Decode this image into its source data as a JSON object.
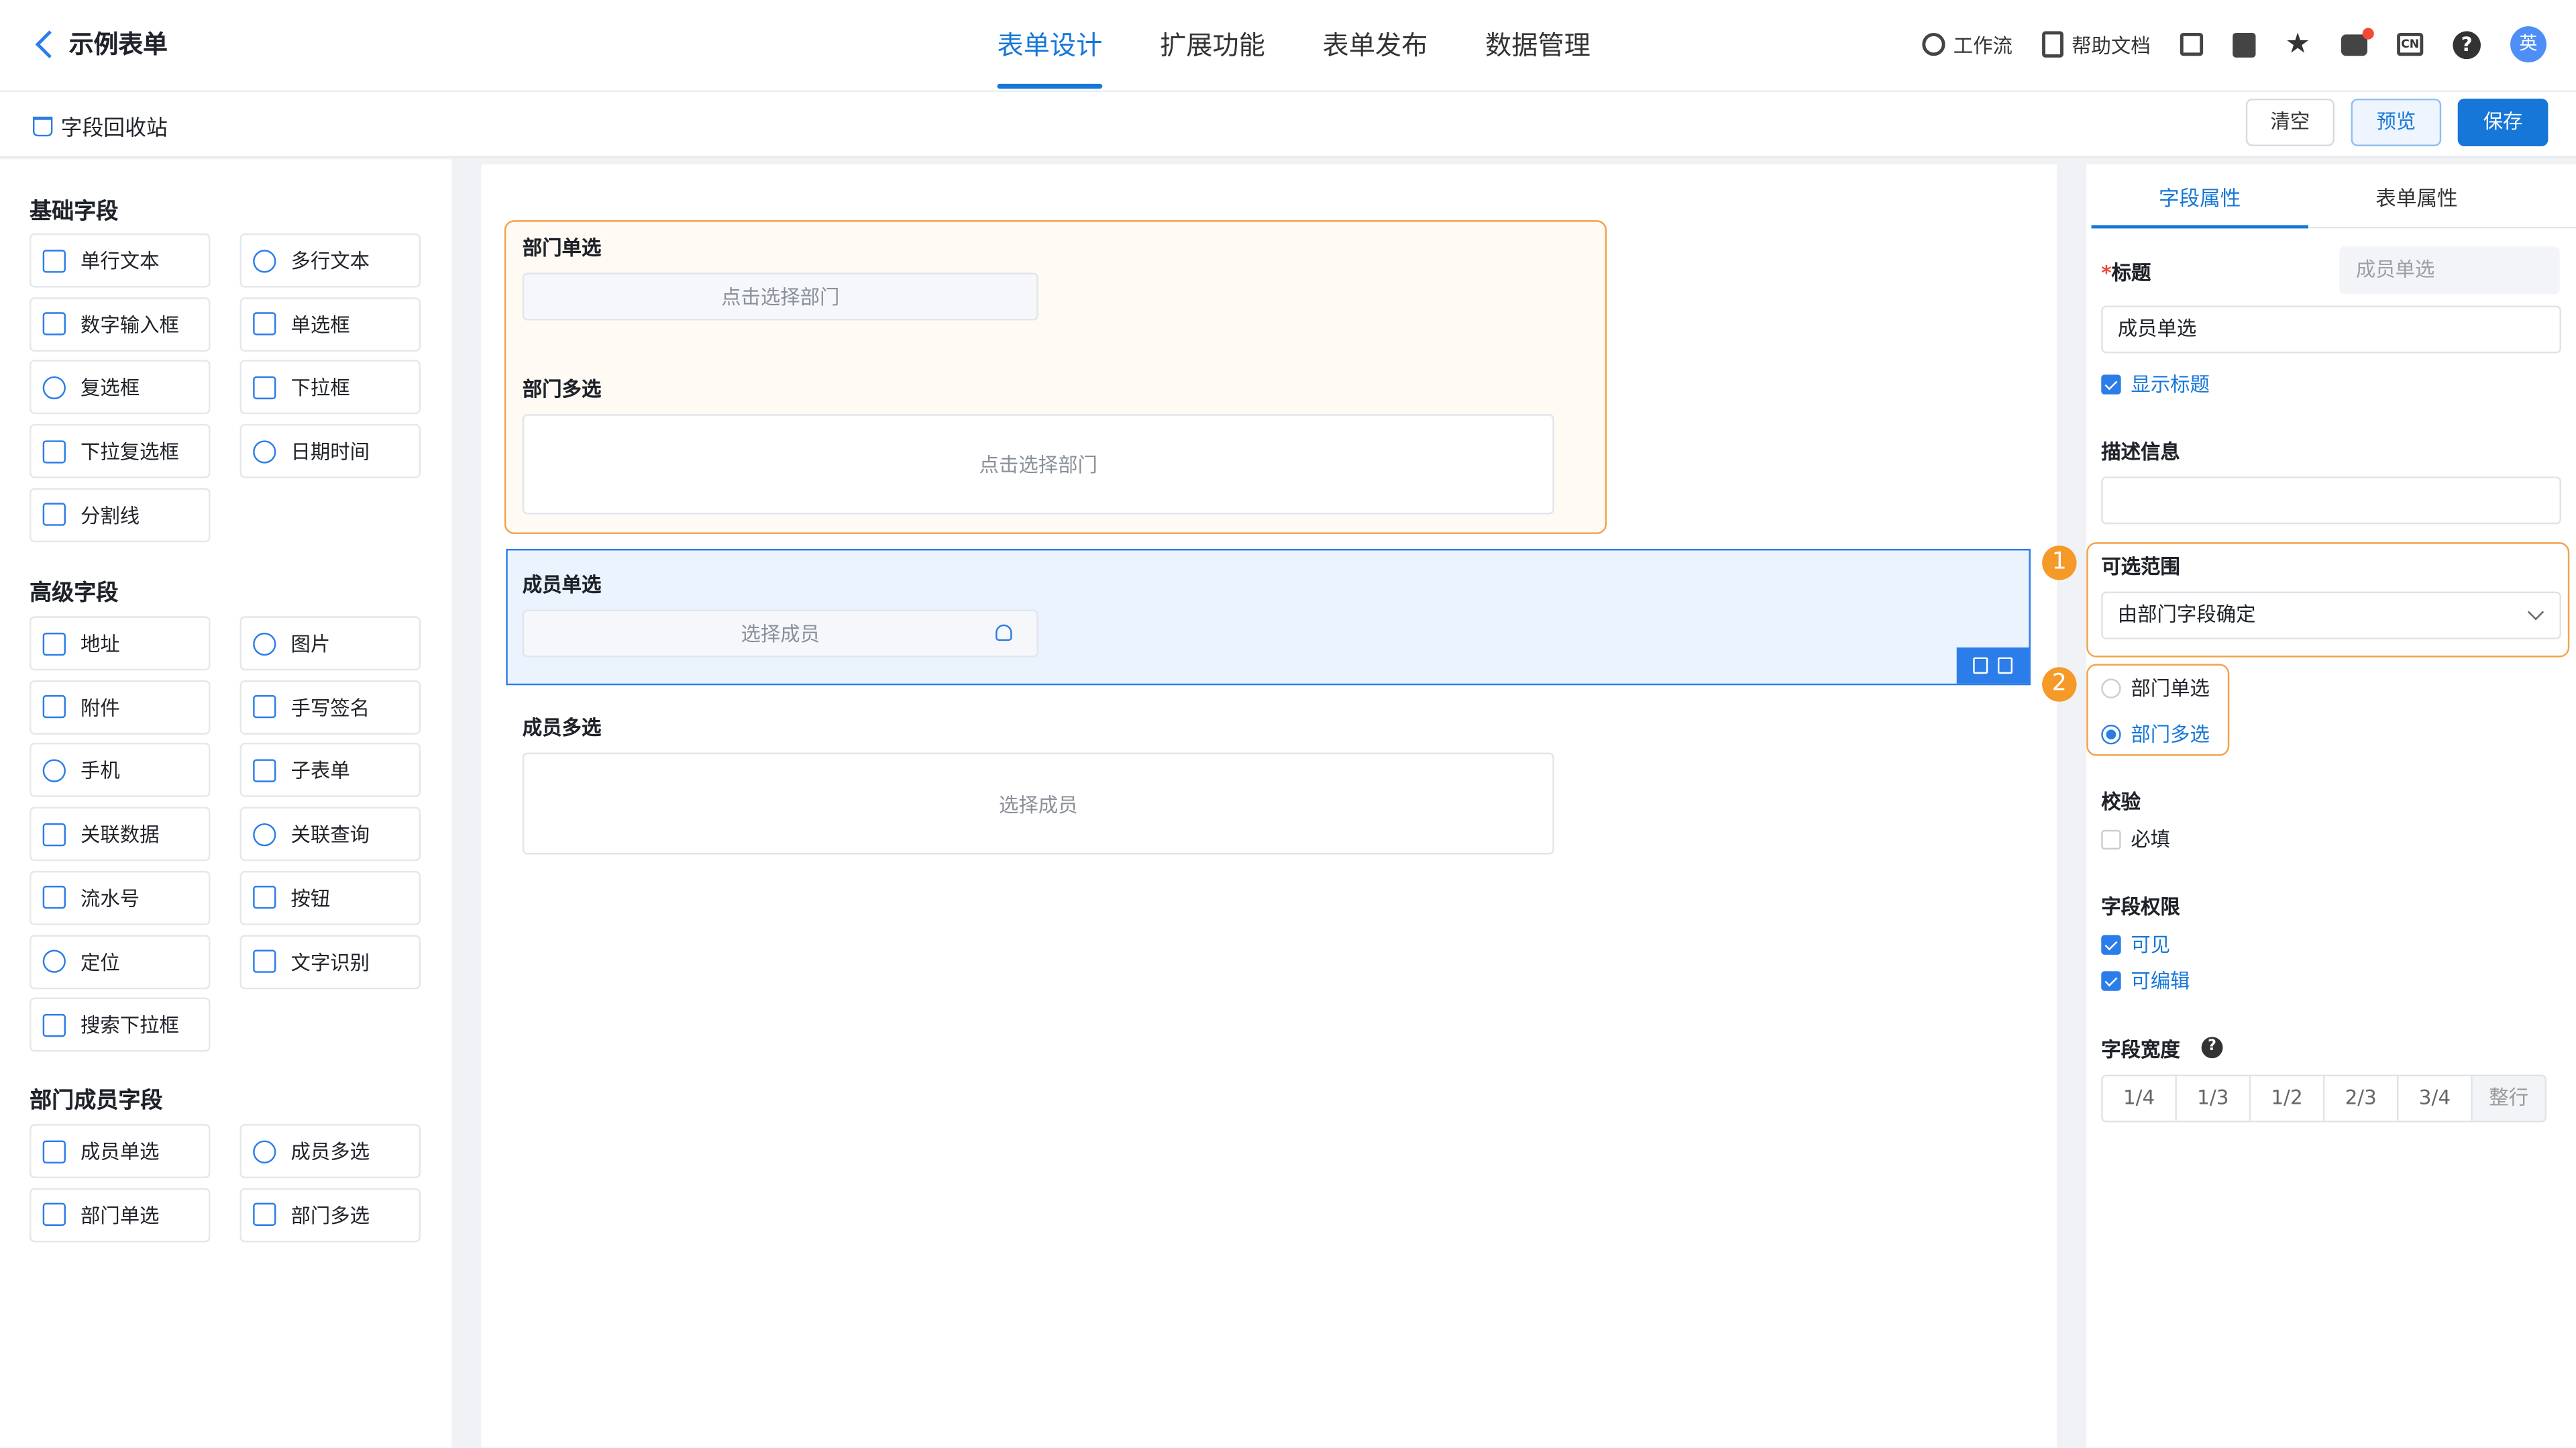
{
  "header": {
    "back_label": "示例表单",
    "tabs": [
      "表单设计",
      "扩展功能",
      "表单发布",
      "数据管理"
    ],
    "right": {
      "workflow": "工作流",
      "help_docs": "帮助文档",
      "avatar": "英",
      "lang": "CN",
      "help": "?"
    }
  },
  "toolbar": {
    "recycle": "字段回收站",
    "clear": "清空",
    "preview": "预览",
    "save": "保存"
  },
  "left": {
    "basic_title": "基础字段",
    "basic": [
      "单行文本",
      "多行文本",
      "数字输入框",
      "单选框",
      "复选框",
      "下拉框",
      "下拉复选框",
      "日期时间",
      "分割线"
    ],
    "advanced_title": "高级字段",
    "advanced": [
      "地址",
      "图片",
      "附件",
      "手写签名",
      "手机",
      "子表单",
      "关联数据",
      "关联查询",
      "流水号",
      "按钮",
      "定位",
      "文字识别",
      "搜索下拉框"
    ],
    "dept_title": "部门成员字段",
    "dept": [
      "成员单选",
      "成员多选",
      "部门单选",
      "部门多选"
    ]
  },
  "canvas": {
    "dept_single_label": "部门单选",
    "dept_single_ph": "点击选择部门",
    "dept_multi_label": "部门多选",
    "dept_multi_ph": "点击选择部门",
    "member_single_label": "成员单选",
    "member_single_ph": "选择成员",
    "member_multi_label": "成员多选",
    "member_multi_ph": "选择成员"
  },
  "right": {
    "tab_field": "字段属性",
    "tab_form": "表单属性",
    "title_label": "标题",
    "title_required": "*",
    "title_hint": "成员单选",
    "title_value": "成员单选",
    "show_title": "显示标题",
    "desc_label": "描述信息",
    "range_label": "可选范围",
    "range_value": "由部门字段确定",
    "radio_single": "部门单选",
    "radio_multi": "部门多选",
    "validate_label": "校验",
    "required": "必填",
    "perm_label": "字段权限",
    "visible": "可见",
    "editable": "可编辑",
    "width_label": "字段宽度",
    "width_options": [
      "1/4",
      "1/3",
      "1/2",
      "2/3",
      "3/4",
      "整行"
    ],
    "marker1": "1",
    "marker2": "2"
  }
}
